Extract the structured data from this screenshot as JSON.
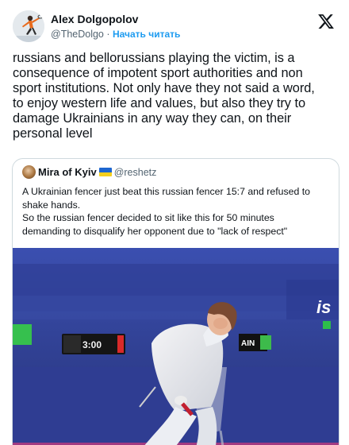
{
  "author": {
    "display_name": "Alex Dolgopolov",
    "handle": "@TheDolgo",
    "separator": " · ",
    "follow_label": "Начать читать"
  },
  "platform_icon": "x-logo-icon",
  "tweet": {
    "lines": [
      "russians and bellorussians playing the victim, is a",
      "consequence of impotent sport authorities and non",
      "sport institutions. Not only have they not said a word,",
      "to enjoy western life and values, but also they try to",
      "damage Ukrainians in any way they can, on their",
      "personal level"
    ]
  },
  "quoted": {
    "display_name": "Mira of Kyiv",
    "flag_icon": "ukraine-flag-icon",
    "handle": "@reshetz",
    "lines": [
      "A Ukrainian fencer just beat this russian fencer 15:7 and refused to",
      "shake hands.",
      "So the russian fencer decided to sit like this for 50 minutes",
      "demanding to disqualify her opponent due to \"lack of respect\""
    ],
    "media": {
      "scoreboard_time": "3:00",
      "sign_text": "AIN",
      "brand_text": "is"
    }
  },
  "colors": {
    "link": "#1d9bf0",
    "secondary_text": "#536471",
    "border": "#cfd9de",
    "flag_blue": "#1e66d0",
    "flag_yellow": "#f5cf1d"
  }
}
